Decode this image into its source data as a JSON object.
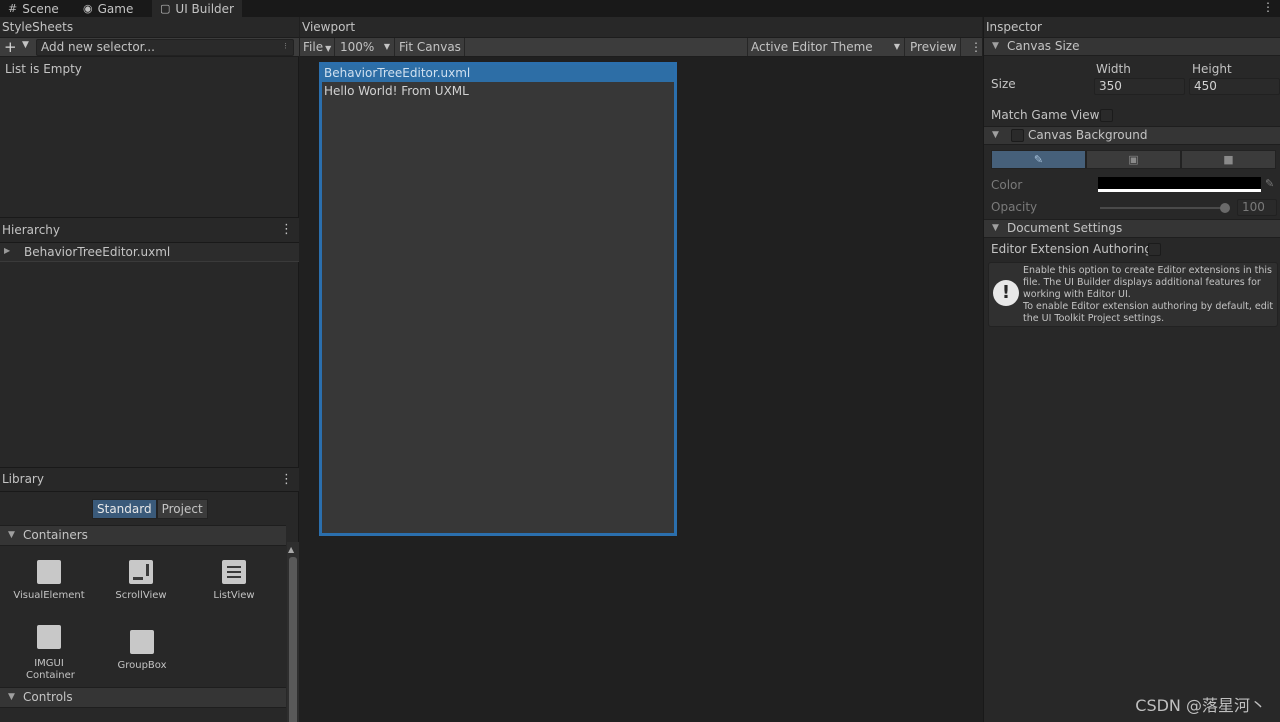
{
  "tabs": [
    {
      "label": "Scene",
      "icon": "grid-icon"
    },
    {
      "label": "Game",
      "icon": "gamepad-icon"
    },
    {
      "label": "UI Builder",
      "icon": "ui-builder-icon",
      "active": true
    }
  ],
  "stylesheets": {
    "title": "StyleSheets",
    "selector_placeholder": "Add new selector...",
    "empty_text": "List is Empty"
  },
  "hierarchy": {
    "title": "Hierarchy",
    "root": "BehaviorTreeEditor.uxml"
  },
  "library": {
    "title": "Library",
    "tabs": [
      "Standard",
      "Project"
    ],
    "active_tab": "Standard",
    "sections": {
      "containers": {
        "label": "Containers",
        "items": [
          "VisualElement",
          "ScrollView",
          "ListView",
          "IMGUI Container",
          "GroupBox"
        ]
      },
      "controls": {
        "label": "Controls"
      }
    }
  },
  "viewport": {
    "title": "Viewport",
    "toolbar": {
      "file": "File",
      "zoom": "100%",
      "fit_canvas": "Fit Canvas",
      "theme": "Active Editor Theme",
      "preview": "Preview"
    },
    "canvas": {
      "title": "BehaviorTreeEditor.uxml",
      "content": "Hello World! From UXML"
    }
  },
  "inspector": {
    "title": "Inspector",
    "canvas_size": {
      "section": "Canvas Size",
      "size_label": "Size",
      "width_label": "Width",
      "height_label": "Height",
      "width": "350",
      "height": "450",
      "match_game_view": "Match Game View"
    },
    "canvas_background": {
      "section": "Canvas Background",
      "color_label": "Color",
      "opacity_label": "Opacity",
      "opacity": "100",
      "color_value": "#000000"
    },
    "document_settings": {
      "section": "Document Settings",
      "editor_extension": "Editor Extension Authoring",
      "help": "Enable this option to create Editor extensions in this file. The UI Builder displays additional features for working with Editor UI.\nTo enable Editor extension authoring by default, edit the UI Toolkit Project settings."
    }
  },
  "watermark": "CSDN @落星河丶",
  "colors": {
    "accent": "#2d6ea6",
    "panel": "#282828",
    "background": "#202020"
  }
}
